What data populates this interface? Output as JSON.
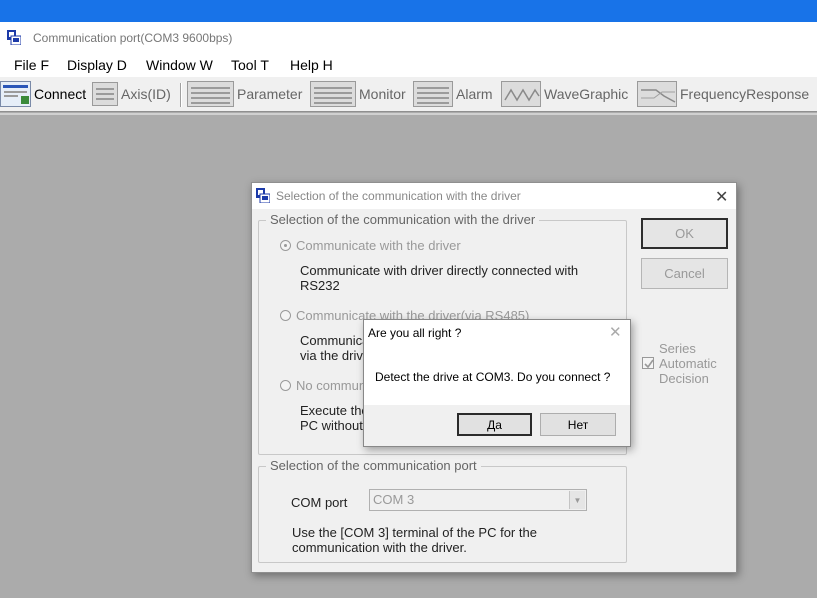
{
  "window": {
    "title": "Communication port(COM3 9600bps)",
    "icon": "app-computer-icon"
  },
  "menu": [
    {
      "label": "File F"
    },
    {
      "label": "Display D"
    },
    {
      "label": "Window W"
    },
    {
      "label": "Tool T"
    },
    {
      "label": "Help H"
    }
  ],
  "toolbar": [
    {
      "label": "Connect",
      "icon": "connect-icon"
    },
    {
      "label": "Axis(ID)",
      "icon": "axis-icon"
    },
    {
      "label": "Parameter",
      "icon": "parameter-icon"
    },
    {
      "label": "Monitor",
      "icon": "monitor-icon"
    },
    {
      "label": "Alarm",
      "icon": "alarm-icon"
    },
    {
      "label": "WaveGraphic",
      "icon": "wavegraphic-icon"
    },
    {
      "label": "FrequencyResponse",
      "icon": "frequencyresponse-icon"
    }
  ],
  "dialog": {
    "title": "Selection of the communication with the driver",
    "group_comm": {
      "legend": "Selection of the communication with the driver",
      "options": [
        {
          "label": "Communicate with the driver",
          "desc": [
            "Communicate with driver directly connected with",
            "RS232"
          ],
          "selected": true
        },
        {
          "label": "Communicate with the driver(via RS485)",
          "desc": [
            "Communicate",
            "via the drive"
          ],
          "selected": false
        },
        {
          "label": "No commun",
          "desc": [
            "Execute the",
            "PC without"
          ],
          "selected": false
        }
      ]
    },
    "group_port": {
      "legend": "Selection of the communication port",
      "com_label": "COM port",
      "com_value": "COM 3",
      "desc": [
        "Use the [COM 3] terminal of the PC for the",
        "communication with the driver."
      ]
    },
    "ok_label": "OK",
    "cancel_label": "Cancel",
    "series_check": {
      "label": [
        "Series",
        "Automatic",
        "Decision"
      ],
      "checked": true
    }
  },
  "msgbox": {
    "title": "Are you all right ?",
    "text": "Detect the drive at COM3. Do you connect ?",
    "yes_label": "Да",
    "no_label": "Нет"
  }
}
